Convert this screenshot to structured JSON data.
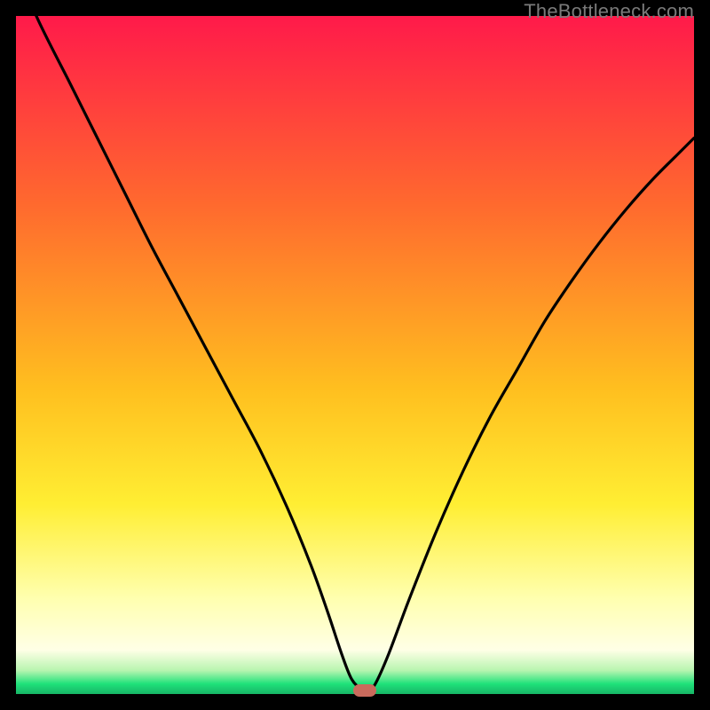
{
  "watermark": "TheBottleneck.com",
  "colors": {
    "top": "#ff1a4a",
    "mid1": "#ff6a2e",
    "mid2": "#ffbf1f",
    "mid3": "#ffee33",
    "pale": "#ffffcc",
    "green": "#1fe27a",
    "frame": "#000000",
    "curve": "#000000",
    "marker": "#c96a5c"
  },
  "chart_data": {
    "type": "line",
    "title": "",
    "xlabel": "",
    "ylabel": "",
    "xlim": [
      0,
      100
    ],
    "ylim": [
      0,
      100
    ],
    "x": [
      0,
      3,
      8,
      12,
      16,
      20,
      24,
      28,
      32,
      36,
      40,
      43.5,
      46,
      48,
      49.5,
      51,
      52,
      53,
      55,
      58,
      62,
      66,
      70,
      74,
      78,
      82,
      86,
      90,
      94,
      98,
      100
    ],
    "y": [
      108,
      100,
      90,
      82,
      74,
      66,
      58.5,
      51,
      43.5,
      36,
      27.5,
      19,
      12,
      6,
      2.2,
      0.7,
      0.5,
      1.5,
      6,
      14,
      24,
      33,
      41,
      48,
      55,
      61,
      66.5,
      71.5,
      76,
      80,
      82
    ],
    "marker": {
      "x": 51.5,
      "y": 0.5
    },
    "gradient_stops": [
      {
        "pos": 0.0,
        "color": "#ff1a4a"
      },
      {
        "pos": 0.28,
        "color": "#ff6a2e"
      },
      {
        "pos": 0.55,
        "color": "#ffbf1f"
      },
      {
        "pos": 0.72,
        "color": "#ffee33"
      },
      {
        "pos": 0.86,
        "color": "#ffffb0"
      },
      {
        "pos": 0.935,
        "color": "#ffffe6"
      },
      {
        "pos": 0.965,
        "color": "#b8f5b0"
      },
      {
        "pos": 0.985,
        "color": "#1fe27a"
      },
      {
        "pos": 1.0,
        "color": "#17b566"
      }
    ]
  }
}
